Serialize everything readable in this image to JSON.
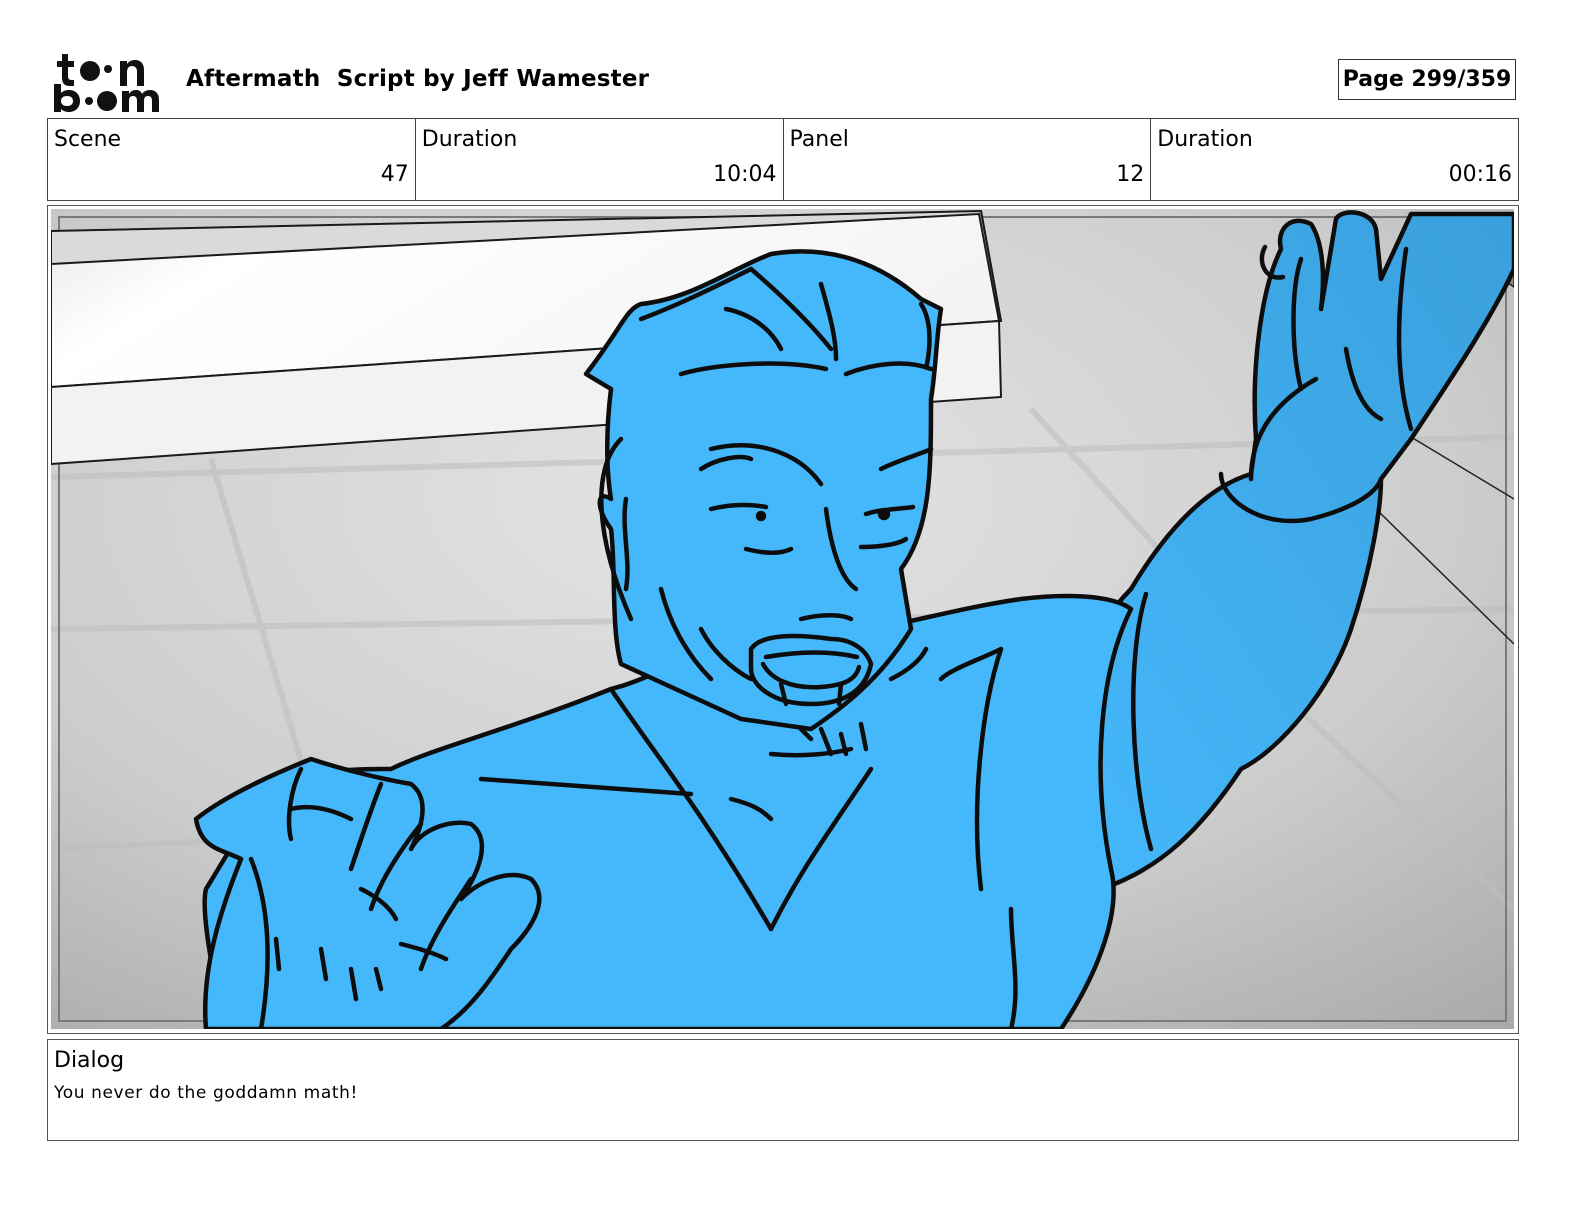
{
  "logo": {
    "line1": "toon",
    "line2": "boom"
  },
  "header": {
    "title": "Aftermath  Script by Jeff Wamester",
    "page": "Page 299/359"
  },
  "info": [
    {
      "label": "Scene",
      "value": "47"
    },
    {
      "label": "Duration",
      "value": "10:04"
    },
    {
      "label": "Panel",
      "value": "12"
    },
    {
      "label": "Duration",
      "value": "00:16"
    }
  ],
  "dialog": {
    "label": "Dialog",
    "text": "You never do the goddamn math!"
  },
  "colors": {
    "character_fill": "#45b8fb",
    "character_shadow": "#3a9fdc",
    "background_gray": "#cfcfcf"
  }
}
